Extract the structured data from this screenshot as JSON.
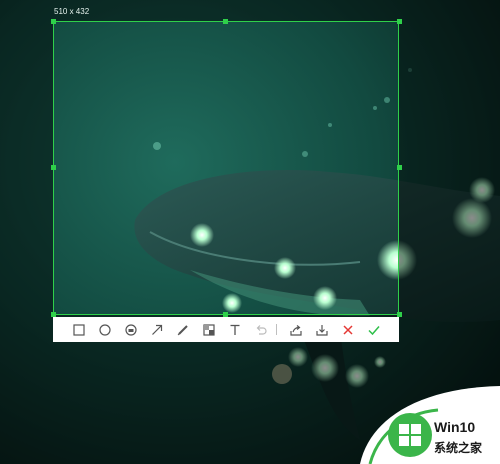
{
  "selection": {
    "size_label": "510 x 432"
  },
  "toolbar": {
    "tools": [
      {
        "name": "rectangle-icon"
      },
      {
        "name": "ellipse-icon"
      },
      {
        "name": "mosaic-icon"
      },
      {
        "name": "arrow-icon"
      },
      {
        "name": "pen-icon"
      },
      {
        "name": "blur-icon"
      },
      {
        "name": "text-icon"
      },
      {
        "name": "undo-icon"
      },
      {
        "name": "share-icon"
      },
      {
        "name": "download-icon"
      },
      {
        "name": "cancel-icon"
      },
      {
        "name": "confirm-icon"
      }
    ]
  },
  "watermark": {
    "line1": "Win10",
    "line2": "系统之家",
    "colors": {
      "badge": "#3bb54a",
      "logo_red": "#e84a2d",
      "logo_blue": "#1e88e5",
      "logo_green": "#3bb54a",
      "logo_yellow": "#f7b500"
    }
  },
  "colors": {
    "selection_border": "#2fd04a",
    "cancel": "#e53935",
    "confirm": "#2fbf4a",
    "tool": "#555555"
  }
}
